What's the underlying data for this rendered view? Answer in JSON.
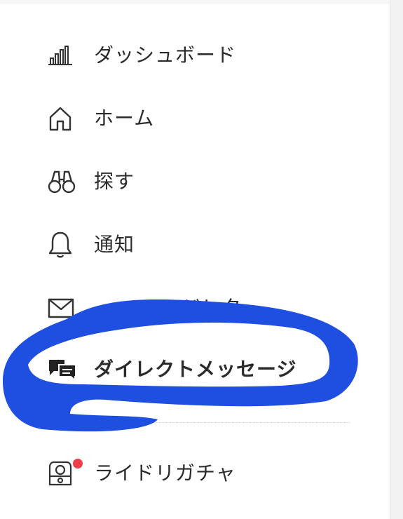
{
  "menu": {
    "items": [
      {
        "label": "ダッシュボード",
        "icon": "bar-chart-icon",
        "active": false
      },
      {
        "label": "ホーム",
        "icon": "home-icon",
        "active": false
      },
      {
        "label": "探す",
        "icon": "binoculars-icon",
        "active": false
      },
      {
        "label": "通知",
        "icon": "bell-icon",
        "active": false
      },
      {
        "label": "ニュースレター",
        "visible_label": "ジレター",
        "icon": "mail-icon",
        "active": false
      },
      {
        "label": "ダイレクトメッセージ",
        "icon": "chat-bubbles-icon",
        "active": true
      },
      {
        "label": "ライドリガチャ",
        "icon": "gacha-icon",
        "active": false,
        "badge": true
      }
    ]
  },
  "annotation": {
    "color": "#1f4fe0"
  },
  "colors": {
    "text": "#2b2b2b",
    "badge": "#ee3e4b"
  }
}
